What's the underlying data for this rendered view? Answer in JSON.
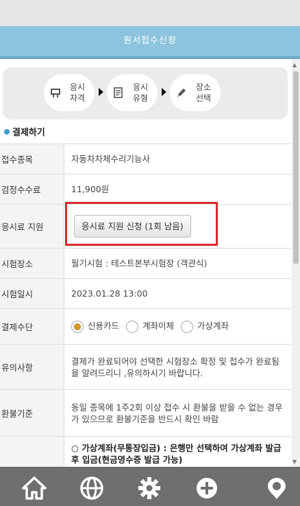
{
  "header": {
    "title": "원서접수신청"
  },
  "steps": [
    {
      "line1": "응시",
      "line2": "자격",
      "icon": "certificate-icon"
    },
    {
      "line1": "응시",
      "line2": "유형",
      "icon": "document-icon"
    },
    {
      "line1": "장소",
      "line2": "선택",
      "icon": "pencil-icon"
    }
  ],
  "section": {
    "title": "결제하기"
  },
  "rows": {
    "subject": {
      "label": "접수종목",
      "value": "자동차차체수리기능사"
    },
    "fee": {
      "label": "검정수수료",
      "value": "11,900원"
    },
    "support": {
      "label": "응시료 지원",
      "button": "응시료 지원 신청 (1회 남음)"
    },
    "place": {
      "label": "시험장소",
      "value": "필기시험 : 테스트본부시험장 (객관식)"
    },
    "datetime": {
      "label": "시험일시",
      "value": "2023.01.28 13:00"
    },
    "payment": {
      "label": "결제수단",
      "opt1": "신용카드",
      "opt2": "계좌이체",
      "opt3": "가상계좌",
      "selected": "신용카드"
    },
    "notice": {
      "label": "유의사항",
      "value": "결제가 완료되어야 선택한 시험장소 확정 및 접수가 완료됨을 알려드리니 ,유의하시기 바랍니다."
    },
    "refund": {
      "label": "환불기준",
      "value": "동일 종목에 1주2회 이상 접수 시 환불을 받을 수 없는 경우가 있으므로 환불기준을 반드시 확인 바람"
    },
    "virtual": {
      "value": "○ 가상계좌(무통장입금) : 은행만 선택하여 가상계좌 발급 후 입금(현금영수증 발급 가능)"
    }
  },
  "nav": [
    "home-icon",
    "globe-icon",
    "gear-icon",
    "plus-icon",
    "location-icon"
  ],
  "colors": {
    "header": "#8cc3dd",
    "accent": "#3b9ad9",
    "highlight": "#d92b2b",
    "nav": "#6f6f6f"
  }
}
